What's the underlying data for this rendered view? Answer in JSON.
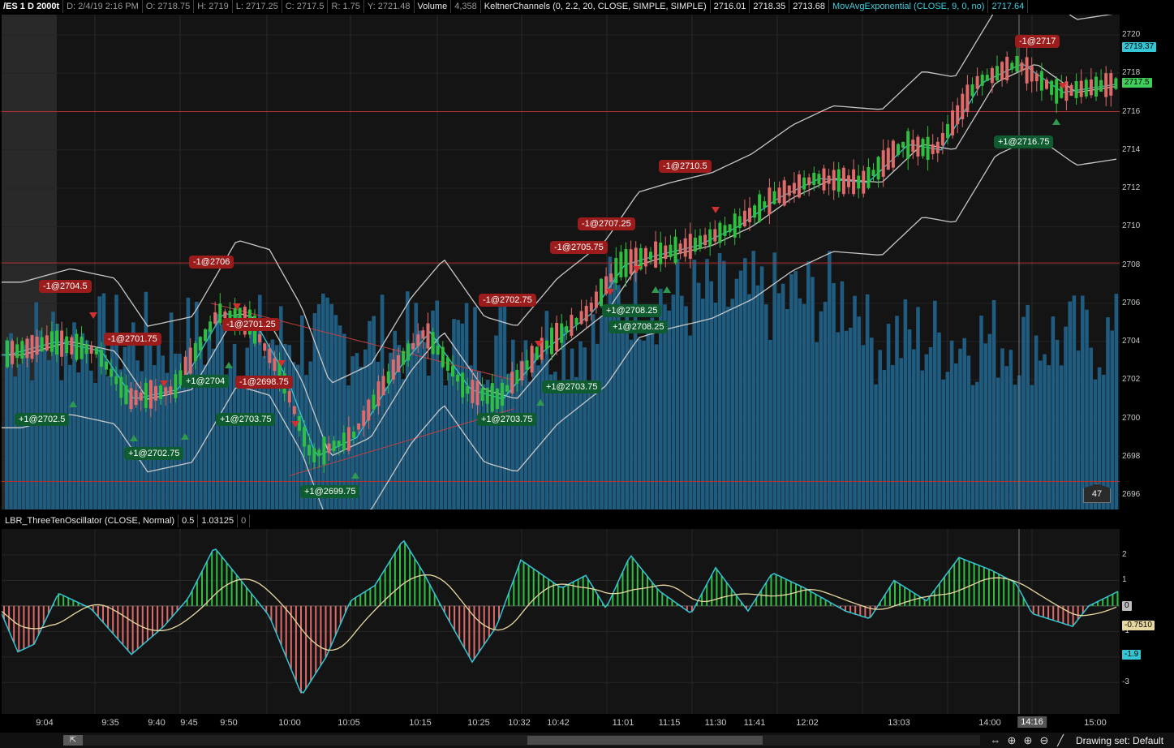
{
  "header": {
    "symbol": "/ES 1 D 2000t",
    "datetime": "D: 2/4/19 2:16 PM",
    "open": "O: 2718.75",
    "high": "H: 2719",
    "low": "L: 2717.25",
    "close": "C: 2717.5",
    "range": "R: 1.75",
    "y": "Y: 2721.48",
    "volume_label": "Volume",
    "volume_value": "4,358",
    "keltner_label": "KeltnerChannels (0, 2.2, 20, CLOSE, SIMPLE, SIMPLE)",
    "keltner_v1": "2716.01",
    "keltner_v2": "2718.35",
    "keltner_v3": "2713.68",
    "ema_label": "MovAvgExponential (CLOSE, 9, 0, no)",
    "ema_value": "2717.64"
  },
  "price_axis": {
    "ticks": [
      "2720",
      "2718",
      "2716",
      "2714",
      "2712",
      "2710",
      "2708",
      "2706",
      "2704",
      "2702",
      "2700",
      "2698",
      "2696"
    ],
    "flag_top": "2719.37",
    "flag_last": "2717.5",
    "colors": {
      "flag_top": "#35c6d6",
      "flag_last": "#3fcf5a"
    }
  },
  "volume_box": "47",
  "trade_tags": [
    {
      "text": "-1@2704.5",
      "side": "sell"
    },
    {
      "text": "-1@2701.75",
      "side": "sell"
    },
    {
      "text": "-1@2706",
      "side": "sell"
    },
    {
      "text": "-1@2701.25",
      "side": "sell"
    },
    {
      "text": "-1@2698.75",
      "side": "sell"
    },
    {
      "text": "-1@2702.75",
      "side": "sell"
    },
    {
      "text": "-1@2705.75",
      "side": "sell"
    },
    {
      "text": "-1@2707.25",
      "side": "sell"
    },
    {
      "text": "-1@2710.5",
      "side": "sell"
    },
    {
      "text": "-1@2717",
      "side": "sell"
    },
    {
      "text": "+1@2702.5",
      "side": "buy"
    },
    {
      "text": "+1@2702.75",
      "side": "buy"
    },
    {
      "text": "+1@2704",
      "side": "buy"
    },
    {
      "text": "+1@2703.75",
      "side": "buy"
    },
    {
      "text": "+1@2699.75",
      "side": "buy"
    },
    {
      "text": "+1@2703.75",
      "side": "buy"
    },
    {
      "text": "+1@2703.75",
      "side": "buy"
    },
    {
      "text": "+1@2708.25",
      "side": "buy"
    },
    {
      "text": "+1@2708.25",
      "side": "buy"
    },
    {
      "text": "+1@2716.75",
      "side": "buy"
    }
  ],
  "oscillator": {
    "label": "LBR_ThreeTenOscillator (CLOSE, Normal)",
    "v1": "0.5",
    "v2": "1.03125",
    "v3": "0",
    "ticks": [
      "2",
      "1",
      "0",
      "-1",
      "-2",
      "-3"
    ],
    "flag_signal": "-0.7510",
    "flag_osc": "-1.9",
    "flag_zero": "0",
    "colors": {
      "signal": "#e8d9a0",
      "osc": "#35c6d6",
      "pos": "#2fbf3f",
      "neg": "#e06a6a"
    }
  },
  "time_axis": {
    "ticks": [
      "9:04",
      "9:35",
      "9:40",
      "9:45",
      "9:50",
      "10:00",
      "10:05",
      "10:15",
      "10:25",
      "10:32",
      "10:42",
      "11:01",
      "11:15",
      "11:30",
      "11:41",
      "12:02",
      "13:03",
      "14:00",
      "15:00"
    ],
    "cursor": "14:16"
  },
  "statusbar": {
    "drawing_set": "Drawing set: Default"
  },
  "colors": {
    "up_candle": "#2fbf3f",
    "down_candle": "#e06a6a",
    "volume": "#1f5c80",
    "keltner": "#c8c8c8",
    "ema": "#35c6d6",
    "hline": "#b03030"
  }
}
